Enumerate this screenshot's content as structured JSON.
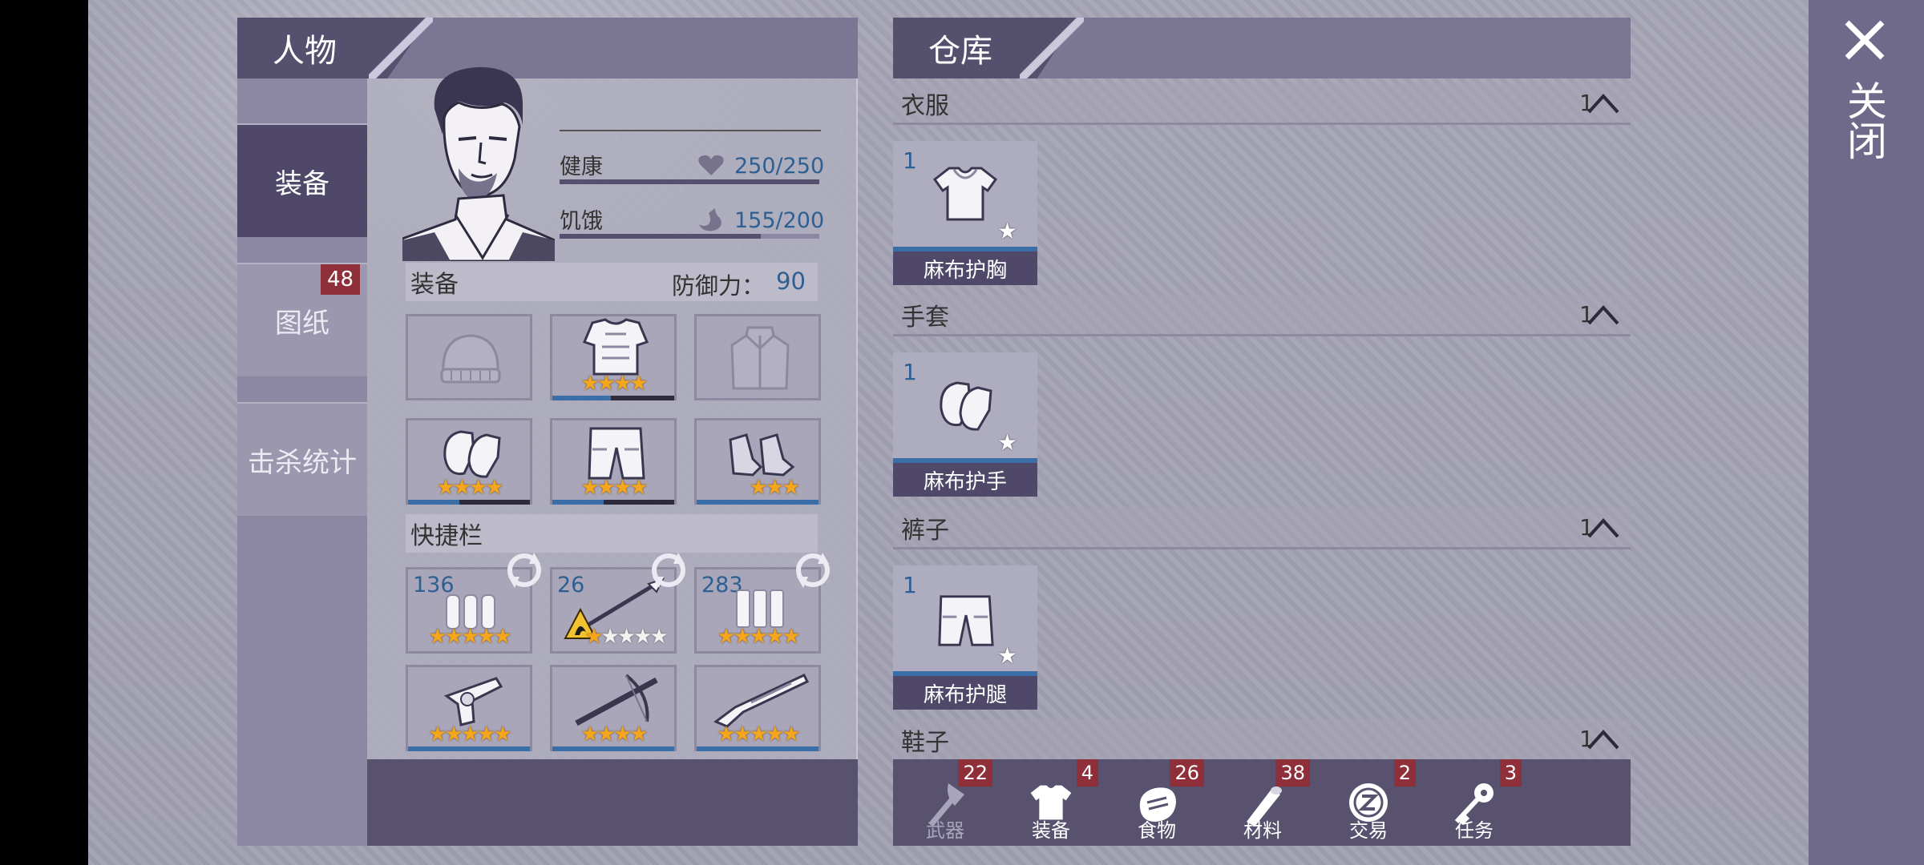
{
  "close": {
    "label": "关闭"
  },
  "character": {
    "tab_title": "人物",
    "side_tabs": [
      {
        "label": "装备",
        "active": true
      },
      {
        "label": "图纸",
        "badge": "48"
      },
      {
        "label": "击杀统计"
      }
    ],
    "health": {
      "label": "健康",
      "value": "250/250",
      "fill": 1.0
    },
    "hunger": {
      "label": "饥饿",
      "value": "155/200",
      "fill": 0.775
    },
    "equipment": {
      "title": "装备",
      "defense_label": "防御力：",
      "defense_value": "90",
      "slots": [
        {
          "icon": "beanie-hat-icon",
          "stars": 0,
          "progress": 0
        },
        {
          "icon": "chest-armor-icon",
          "stars": 4,
          "progress": 0.48
        },
        {
          "icon": "jacket-icon",
          "stars": 0,
          "progress": 0
        },
        {
          "icon": "gloves-icon",
          "stars": 4,
          "progress": 0.42
        },
        {
          "icon": "pants-icon",
          "stars": 4,
          "progress": 0.42
        },
        {
          "icon": "boots-icon",
          "stars": 3,
          "progress": 1.0
        }
      ]
    },
    "quickbar": {
      "title": "快捷栏",
      "slots": [
        {
          "icon": "ammo-icon",
          "qty": "136",
          "stars": 5,
          "stars_total": 5,
          "swap": true
        },
        {
          "icon": "spear-icon",
          "qty": "26",
          "stars": 1,
          "stars_total": 5,
          "swap": true,
          "warning": true
        },
        {
          "icon": "shells-icon",
          "qty": "283",
          "stars": 5,
          "stars_total": 5,
          "swap": true
        },
        {
          "icon": "revolver-icon",
          "stars": 5,
          "stars_total": 5
        },
        {
          "icon": "crossbow-icon",
          "stars": 4,
          "stars_total": 4
        },
        {
          "icon": "shotgun-icon",
          "stars": 5,
          "stars_total": 5
        }
      ]
    }
  },
  "warehouse": {
    "tab_title": "仓库",
    "categories": [
      {
        "label": "衣服",
        "count": "1",
        "item": {
          "qty": "1",
          "name": "麻布护胸",
          "icon": "shirt-icon"
        }
      },
      {
        "label": "手套",
        "count": "1",
        "item": {
          "qty": "1",
          "name": "麻布护手",
          "icon": "gloves-icon"
        }
      },
      {
        "label": "裤子",
        "count": "1",
        "item": {
          "qty": "1",
          "name": "麻布护腿",
          "icon": "pants-icon"
        }
      },
      {
        "label": "鞋子",
        "count": "1"
      }
    ],
    "nav": [
      {
        "label": "武器",
        "badge": "22",
        "icon": "axe-icon",
        "dim": true
      },
      {
        "label": "装备",
        "badge": "4",
        "icon": "shirt-icon"
      },
      {
        "label": "食物",
        "badge": "26",
        "icon": "meat-icon"
      },
      {
        "label": "材料",
        "badge": "38",
        "icon": "log-icon"
      },
      {
        "label": "交易",
        "badge": "2",
        "icon": "coin-icon"
      },
      {
        "label": "任务",
        "badge": "3",
        "icon": "key-icon"
      }
    ]
  },
  "colors": {
    "accent_blue": "#3b6ea6",
    "panel_dark": "#4f4868",
    "badge_red": "#8f2f3a",
    "star_gold": "#f4a71d"
  }
}
